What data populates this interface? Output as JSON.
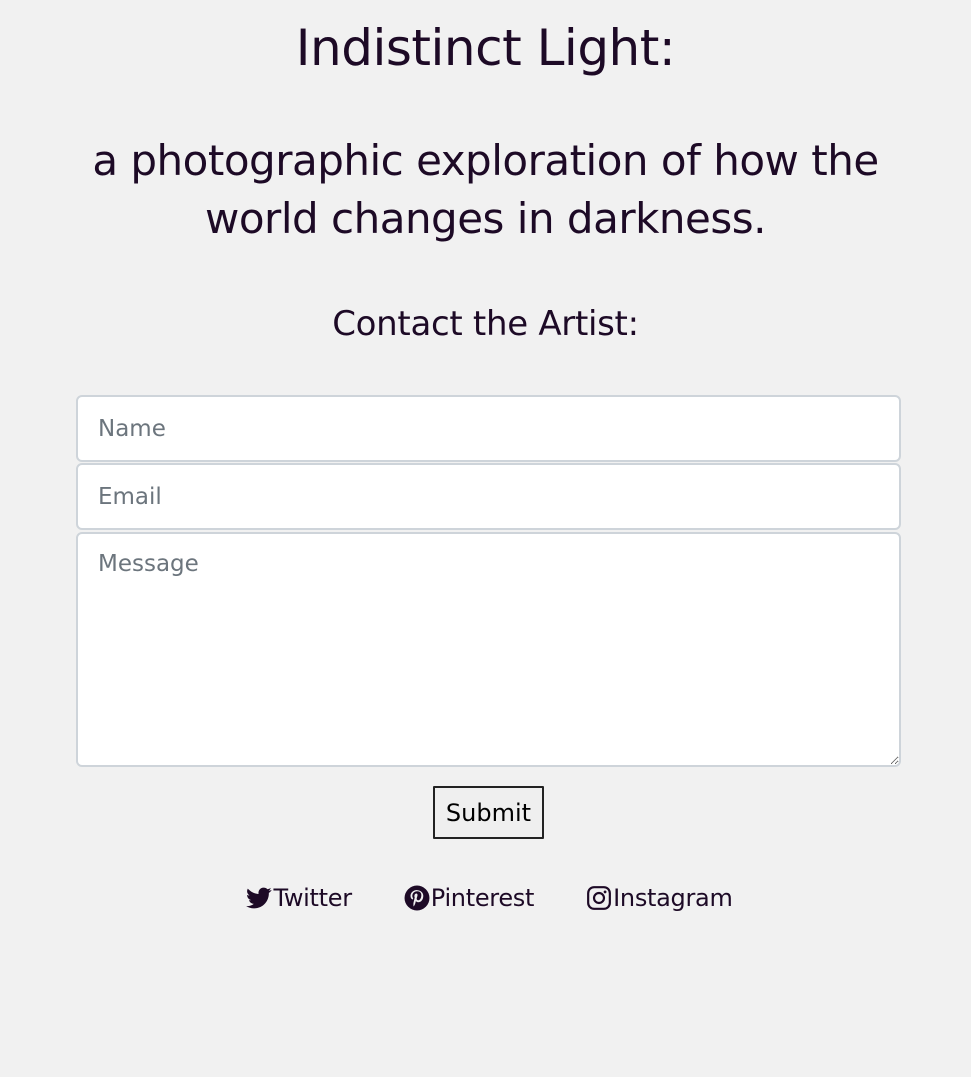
{
  "header": {
    "title": "Indistinct Light:",
    "subtitle": "a photographic exploration of how the world changes in darkness."
  },
  "contact": {
    "heading": "Contact the Artist:",
    "name_placeholder": "Name",
    "email_placeholder": "Email",
    "message_placeholder": "Message",
    "submit_label": "Submit"
  },
  "social": {
    "twitter": {
      "label": "Twitter",
      "icon": "twitter-icon"
    },
    "pinterest": {
      "label": "Pinterest",
      "icon": "pinterest-icon"
    },
    "instagram": {
      "label": "Instagram",
      "icon": "instagram-icon"
    }
  },
  "colors": {
    "background": "#f1f1f1",
    "text": "#1d0a26",
    "input_border": "#ced4da",
    "placeholder": "#6c757d"
  }
}
